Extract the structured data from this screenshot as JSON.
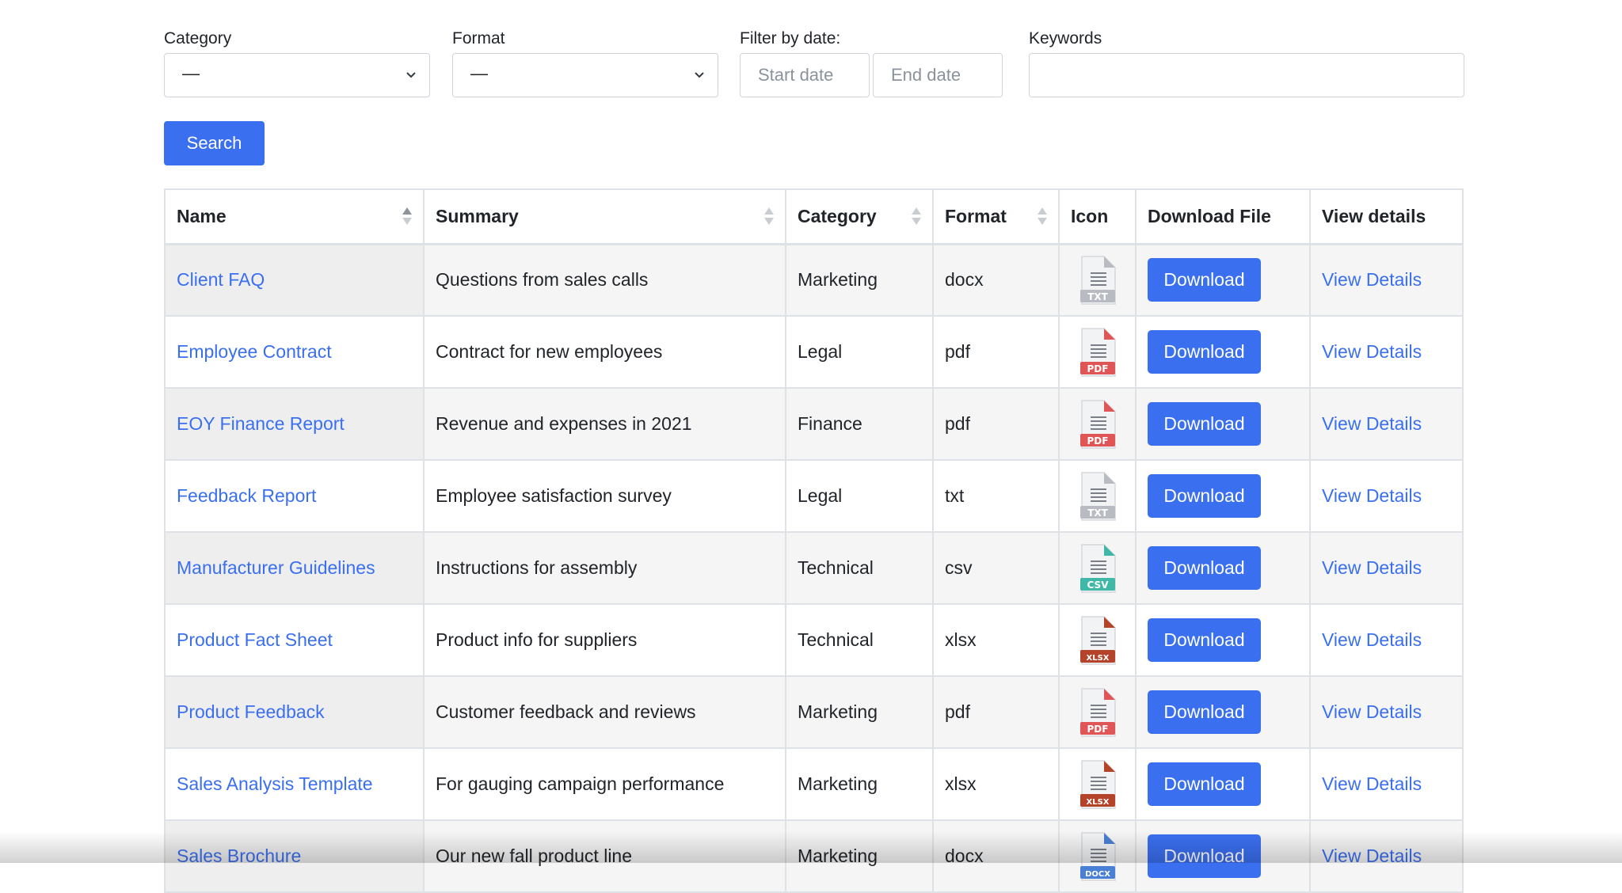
{
  "filters": {
    "category": {
      "label": "Category",
      "value": "—"
    },
    "format": {
      "label": "Format",
      "value": "—"
    },
    "date": {
      "label": "Filter by date:",
      "start_placeholder": "Start date",
      "end_placeholder": "End date"
    },
    "keywords": {
      "label": "Keywords",
      "value": ""
    },
    "search_label": "Search"
  },
  "table": {
    "headers": {
      "name": "Name",
      "summary": "Summary",
      "category": "Category",
      "format": "Format",
      "icon": "Icon",
      "download": "Download File",
      "details": "View details"
    },
    "sort": {
      "column": "name",
      "direction": "ascending"
    },
    "rows": [
      {
        "name": "Client FAQ",
        "summary": "Questions from sales calls",
        "category": "Marketing",
        "format": "docx",
        "icon": "txt-file-icon",
        "download": "Download",
        "details": "View Details"
      },
      {
        "name": "Employee Contract",
        "summary": "Contract for new employees",
        "category": "Legal",
        "format": "pdf",
        "icon": "pdf-file-icon",
        "download": "Download",
        "details": "View Details"
      },
      {
        "name": "EOY Finance Report",
        "summary": "Revenue and expenses in 2021",
        "category": "Finance",
        "format": "pdf",
        "icon": "pdf-file-icon",
        "download": "Download",
        "details": "View Details"
      },
      {
        "name": "Feedback Report",
        "summary": "Employee satisfaction survey",
        "category": "Legal",
        "format": "txt",
        "icon": "txt-file-icon",
        "download": "Download",
        "details": "View Details"
      },
      {
        "name": "Manufacturer Guidelines",
        "summary": "Instructions for assembly",
        "category": "Technical",
        "format": "csv",
        "icon": "csv-file-icon",
        "download": "Download",
        "details": "View Details"
      },
      {
        "name": "Product Fact Sheet",
        "summary": "Product info for suppliers",
        "category": "Technical",
        "format": "xlsx",
        "icon": "xlsx-file-icon",
        "download": "Download",
        "details": "View Details"
      },
      {
        "name": "Product Feedback",
        "summary": "Customer feedback and reviews",
        "category": "Marketing",
        "format": "pdf",
        "icon": "pdf-file-icon",
        "download": "Download",
        "details": "View Details"
      },
      {
        "name": "Sales Analysis Template",
        "summary": "For gauging campaign performance",
        "category": "Marketing",
        "format": "xlsx",
        "icon": "xlsx-file-icon",
        "download": "Download",
        "details": "View Details"
      },
      {
        "name": "Sales Brochure",
        "summary": "Our new fall product line",
        "category": "Marketing",
        "format": "docx",
        "icon": "docx-file-icon",
        "download": "Download",
        "details": "View Details"
      }
    ]
  },
  "icons": {
    "txt-file-icon": {
      "text": "TXT",
      "color": "#b8bcc2"
    },
    "pdf-file-icon": {
      "text": "PDF",
      "color": "#e05555"
    },
    "csv-file-icon": {
      "text": "CSV",
      "color": "#3fb8a8"
    },
    "xlsx-file-icon": {
      "text": "XLSX",
      "color": "#b5432a"
    },
    "docx-file-icon": {
      "text": "DOCX",
      "color": "#4a7fd6"
    }
  },
  "colors": {
    "accent": "#3a6ff0",
    "link": "#3a6ff0"
  }
}
